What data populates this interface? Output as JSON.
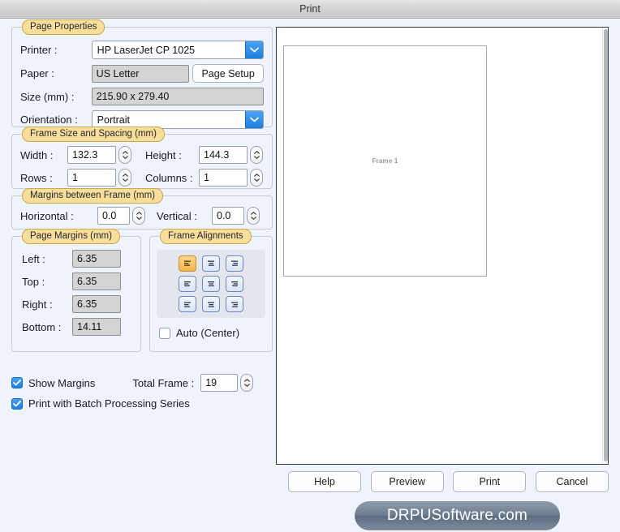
{
  "window": {
    "title": "Print"
  },
  "page_properties": {
    "group_label": "Page Properties",
    "printer_label": "Printer :",
    "printer_value": "HP LaserJet CP 1025",
    "paper_label": "Paper :",
    "paper_value": "US Letter",
    "page_setup_button": "Page Setup",
    "size_label": "Size (mm) :",
    "size_value": "215.90 x 279.40",
    "orientation_label": "Orientation :",
    "orientation_value": "Portrait"
  },
  "frame_size": {
    "group_label": "Frame Size and Spacing (mm)",
    "width_label": "Width :",
    "width_value": "132.3",
    "height_label": "Height :",
    "height_value": "144.3",
    "rows_label": "Rows :",
    "rows_value": "1",
    "columns_label": "Columns :",
    "columns_value": "1"
  },
  "margins_between_frame": {
    "group_label": "Margins between Frame (mm)",
    "horizontal_label": "Horizontal :",
    "horizontal_value": "0.0",
    "vertical_label": "Vertical :",
    "vertical_value": "0.0"
  },
  "page_margins": {
    "group_label": "Page Margins (mm)",
    "left_label": "Left :",
    "left_value": "6.35",
    "top_label": "Top :",
    "top_value": "6.35",
    "right_label": "Right :",
    "right_value": "6.35",
    "bottom_label": "Bottom :",
    "bottom_value": "14.11"
  },
  "frame_alignments": {
    "group_label": "Frame Alignments",
    "selected_index": 0,
    "buttons": [
      "align-top-left",
      "align-top-center",
      "align-top-right",
      "align-middle-left",
      "align-middle-center",
      "align-middle-right",
      "align-bottom-left",
      "align-bottom-center",
      "align-bottom-right"
    ],
    "auto_center_label": "Auto (Center)",
    "auto_center_checked": false
  },
  "options": {
    "show_margins_label": "Show Margins",
    "show_margins_checked": true,
    "batch_processing_label": "Print with Batch Processing Series",
    "batch_processing_checked": true,
    "total_frame_label": "Total Frame :",
    "total_frame_value": "19"
  },
  "preview": {
    "frame_label": "Frame 1"
  },
  "buttons": {
    "help": "Help",
    "preview": "Preview",
    "print": "Print",
    "cancel": "Cancel"
  },
  "watermark": {
    "text": "DRPUSoftware.com"
  },
  "colors": {
    "accent_blue": "#1d82e2",
    "group_label_bg": "#f7de9a",
    "group_label_border": "#c9a94e",
    "active_align": "#f5b44e",
    "dialog_bg": "#eff3fb"
  }
}
